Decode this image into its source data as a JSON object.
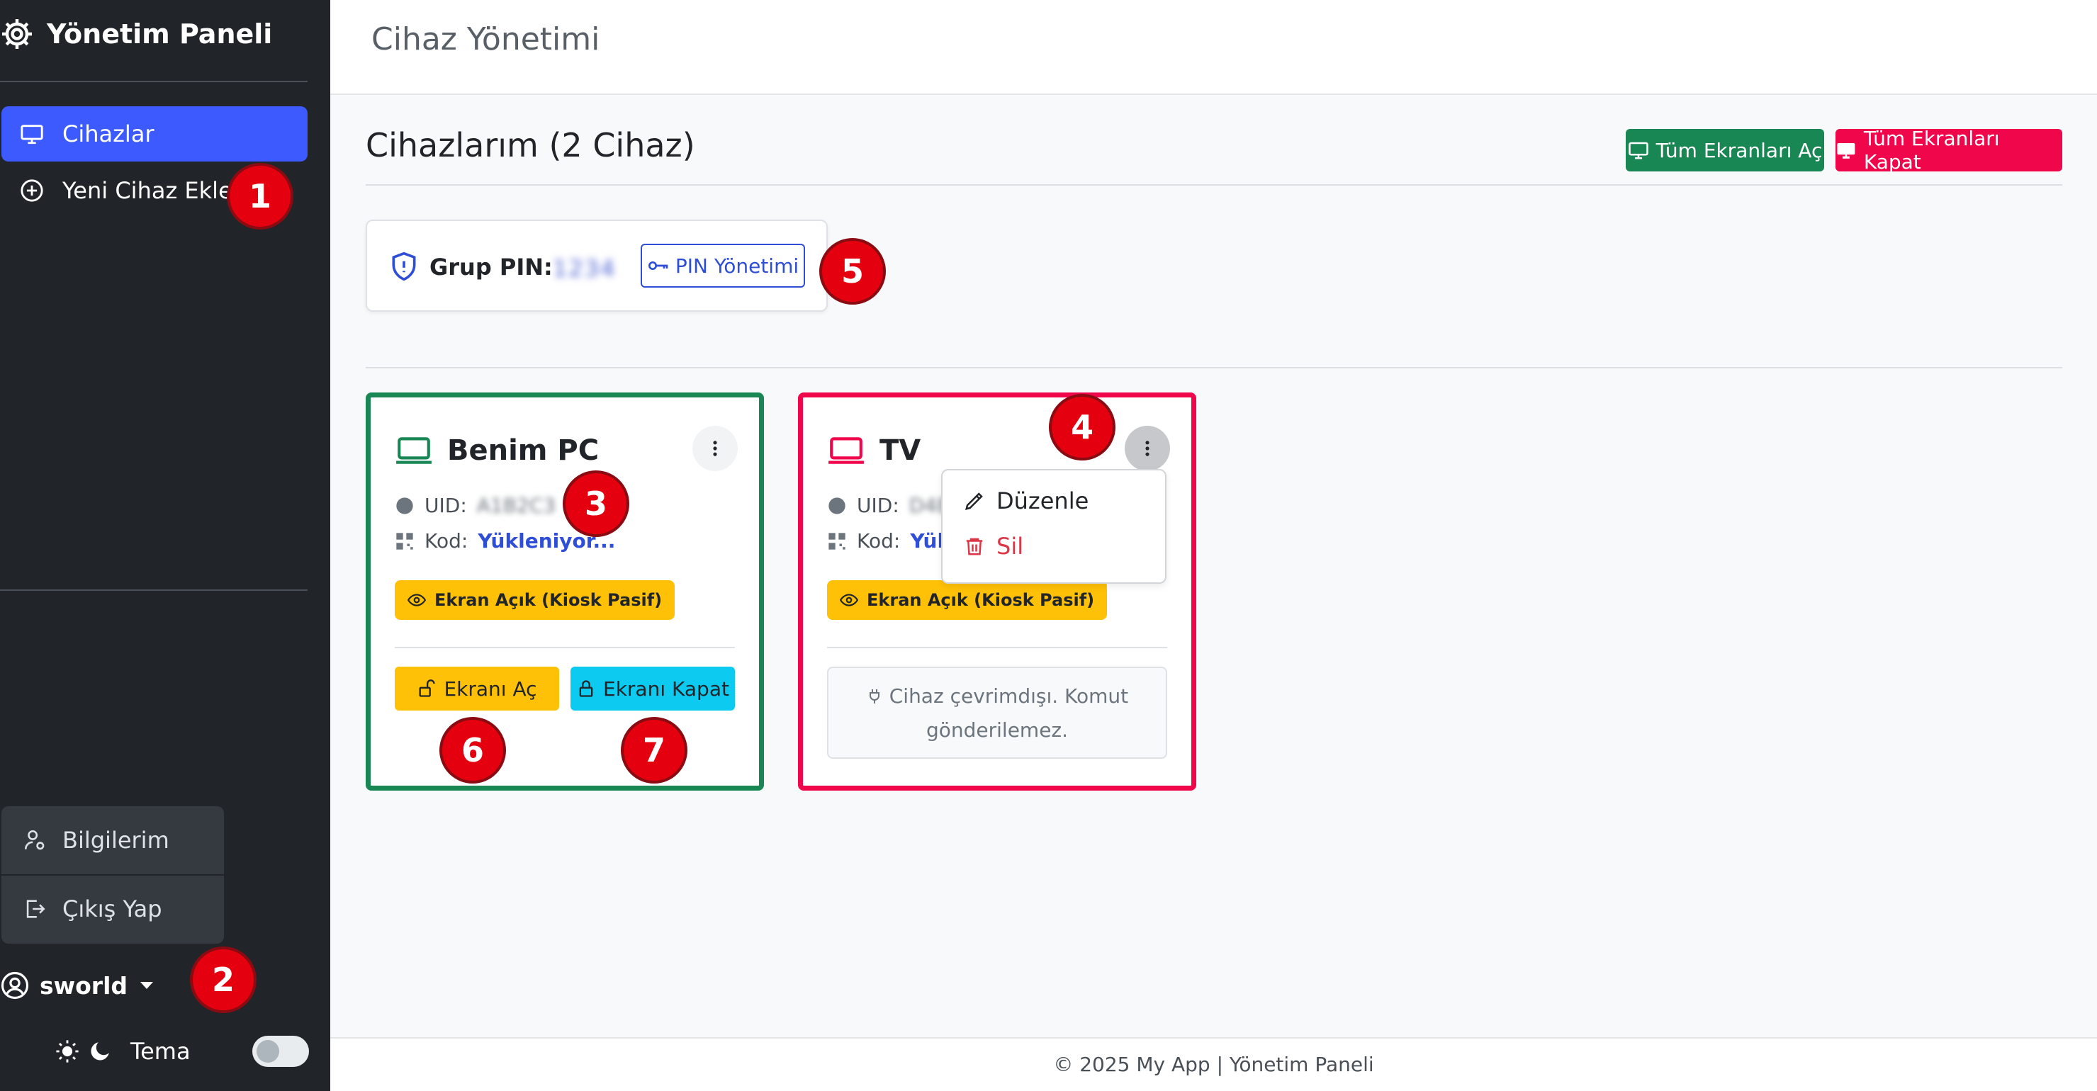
{
  "sidebar": {
    "brand": "Yönetim Paneli",
    "nav": [
      {
        "label": "Cihazlar",
        "icon": "monitor-icon",
        "active": true
      },
      {
        "label": "Yeni Cihaz Ekle",
        "icon": "plus-circle-icon",
        "active": false
      }
    ],
    "user_menu": [
      {
        "label": "Bilgilerim",
        "icon": "user-gear-icon"
      },
      {
        "label": "Çıkış Yap",
        "icon": "logout-icon"
      }
    ],
    "username": "sworld",
    "theme_label": "Tema",
    "theme_dark": false
  },
  "header": {
    "title": "Cihaz Yönetimi"
  },
  "main": {
    "title": "Cihazlarım (2 Cihaz)",
    "open_all_label": "Tüm Ekranları Aç",
    "close_all_label": "Tüm Ekranları Kapat",
    "pin": {
      "label": "Grup PIN:",
      "value": "1234",
      "button_label": "PIN Yönetimi"
    },
    "devices": [
      {
        "name": "Benim PC",
        "status": "online",
        "accent": "#198754",
        "uid_label": "UID:",
        "uid_value": "A1B2C3",
        "code_label": "Kod:",
        "code_value": "Yükleniyor...",
        "badge": "Ekran Açık (Kiosk Pasif)",
        "open_label": "Ekranı Aç",
        "close_label": "Ekranı Kapat"
      },
      {
        "name": "TV",
        "status": "offline",
        "accent": "#f0064a",
        "uid_label": "UID:",
        "uid_value": "D4E5",
        "code_label": "Kod:",
        "code_value": "Yükl",
        "badge": "Ekran Açık (Kiosk Pasif)",
        "offline_message": "Cihaz çevrimdışı. Komut gönderilemez."
      }
    ],
    "dropdown": {
      "edit_label": "Düzenle",
      "delete_label": "Sil"
    }
  },
  "markers": [
    "1",
    "2",
    "3",
    "4",
    "5",
    "6",
    "7"
  ],
  "footer": "© 2025 My App | Yönetim Paneli",
  "colors": {
    "primary": "#3d5afe",
    "success": "#198754",
    "danger": "#f0064a",
    "warning": "#ffc107",
    "info": "#0dcaf0",
    "sidebar": "#212529"
  }
}
